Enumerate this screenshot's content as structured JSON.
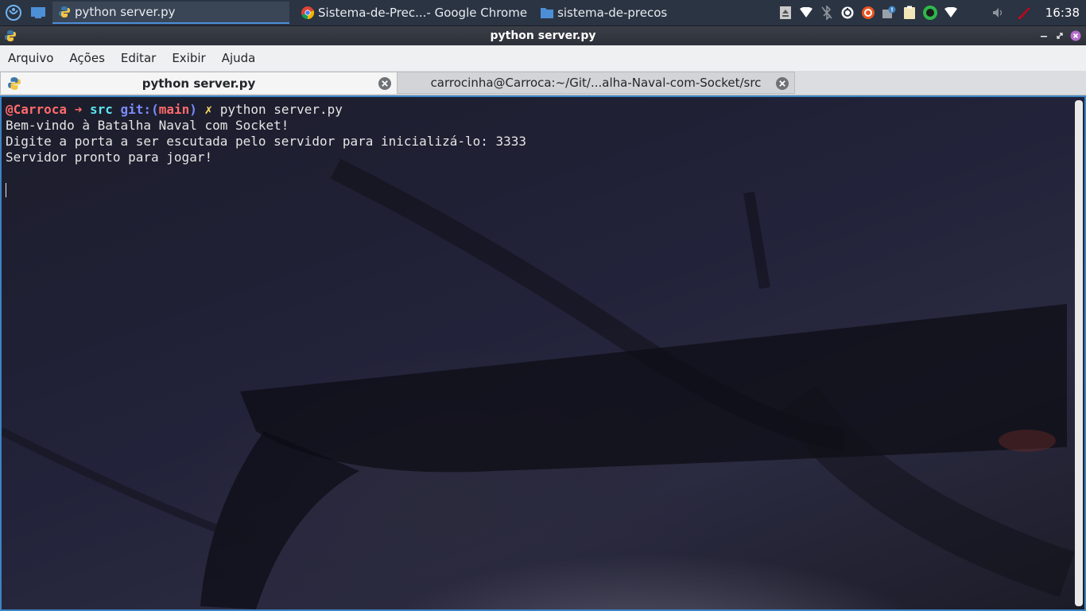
{
  "taskbar": {
    "tasks": [
      {
        "label": "python server.py",
        "icon": "python-icon"
      },
      {
        "label": "Sistema-de-Prec...- Google Chrome",
        "icon": "chrome-icon"
      },
      {
        "label": "sistema-de-precos",
        "icon": "folder-icon"
      }
    ],
    "clock": "16:38",
    "tray_icons": [
      "usb-drive-icon",
      "wifi-icon",
      "bluetooth-off-icon",
      "sync-icon",
      "update-icon",
      "notification-icon",
      "clipboard-icon",
      "green-circle-icon",
      "network-icon",
      "volume-icon",
      "battery-icon"
    ]
  },
  "window": {
    "title": "python server.py"
  },
  "menubar": {
    "items": [
      "Arquivo",
      "Ações",
      "Editar",
      "Exibir",
      "Ajuda"
    ]
  },
  "tabs": [
    {
      "label": "python server.py",
      "active": true
    },
    {
      "label": "carrocinha@Carroca:~/Git/...alha-Naval-com-Socket/src",
      "active": false
    }
  ],
  "terminal": {
    "prompt": {
      "user": "@Carroca",
      "arrow": "➜",
      "dir": "src",
      "git_label": "git:(",
      "branch": "main",
      "git_close": ")",
      "dirty": "✗",
      "command": "python server.py"
    },
    "lines": [
      "Bem-vindo à Batalha Naval com Socket!",
      "Digite a porta a ser escutada pelo servidor para inicializá-lo: 3333",
      "Servidor pronto para jogar!"
    ]
  },
  "colors": {
    "panel_bg": "#2b3442",
    "accent": "#3d83c4",
    "prompt_red": "#ff6b6b",
    "prompt_cyan": "#5be6f0",
    "prompt_blue": "#7b8cff",
    "prompt_yellow": "#ffe066"
  }
}
